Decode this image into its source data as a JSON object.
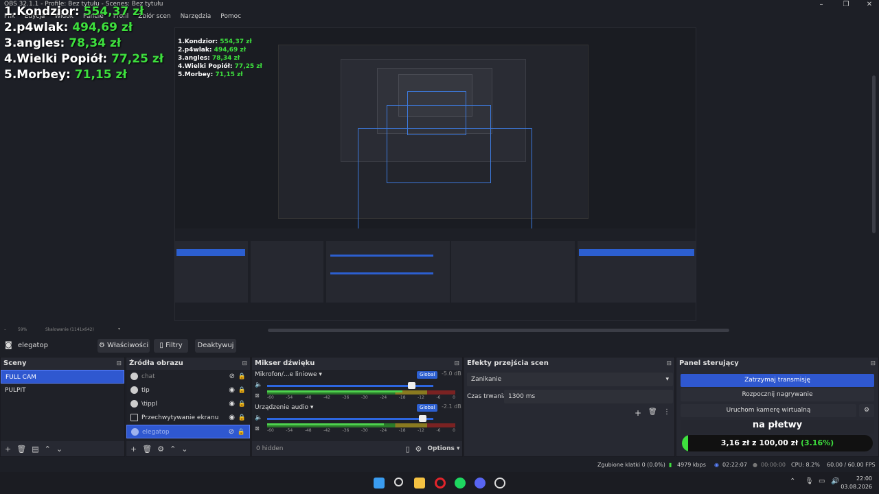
{
  "window": {
    "title": "OBS 32.1.1 - Profile: Bez tytułu - Scenes: Bez tytułu",
    "minimize": "–",
    "maximize": "❐",
    "close": "✕"
  },
  "menu": [
    "Plik",
    "Edycja",
    "Widok",
    "Panele",
    "Profil",
    "Zbiór scen",
    "Narzędzia",
    "Pomoc"
  ],
  "leaderboard": [
    {
      "rank": "1.",
      "name": "Kondzior:",
      "amount": "554,37 zł"
    },
    {
      "rank": "2.",
      "name": "p4wlak:",
      "amount": "494,69 zł"
    },
    {
      "rank": "3.",
      "name": "angles:",
      "amount": "78,34 zł"
    },
    {
      "rank": "4.",
      "name": "Wielki Popiół:",
      "amount": "77,25 zł"
    },
    {
      "rank": "5.",
      "name": "Morbey:",
      "amount": "71,15 zł"
    }
  ],
  "zoom": {
    "percent": "59%",
    "scaling": "Skalowanie (1141x642)"
  },
  "source_toolbar": {
    "source_name": "elegatop",
    "properties": "Właściwości",
    "filters": "Filtry",
    "deactivate": "Deaktywuj"
  },
  "scenes": {
    "title": "Sceny",
    "items": [
      "FULL CAM",
      "PULPIT"
    ]
  },
  "sources": {
    "title": "Źródła obrazu",
    "items": [
      {
        "name": "chat",
        "visible": false
      },
      {
        "name": "tip",
        "visible": true
      },
      {
        "name": "\\tippl",
        "visible": true
      },
      {
        "name": "Przechwytywanie ekranu",
        "visible": true
      },
      {
        "name": "elegatop",
        "visible": false
      }
    ]
  },
  "mixer": {
    "title": "Mikser dźwięku",
    "channels": [
      {
        "name": "Mikrofon/...e liniowe",
        "badge": "Global",
        "db": "-5.0 dB",
        "volume": 0.87,
        "level": 0.72
      },
      {
        "name": "Urządzenie audio",
        "badge": "Global",
        "db": "-2.1 dB",
        "volume": 0.94,
        "level": 0.62
      }
    ],
    "scale": [
      "-60",
      "-54",
      "-48",
      "-42",
      "-36",
      "-30",
      "-24",
      "-18",
      "-12",
      "-6",
      "0"
    ],
    "hidden": "0 hidden",
    "options": "Options"
  },
  "transitions": {
    "title": "Efekty przejścia scen",
    "selected": "Zanikanie",
    "duration_label": "Czas trwania",
    "duration_value": "1300 ms"
  },
  "controls": {
    "title": "Panel sterujący",
    "stop_stream": "Zatrzymaj transmisję",
    "start_record": "Rozpocznij nagrywanie",
    "virtual_cam": "Uruchom kamerę wirtualną",
    "goal_title": "na płetwy",
    "goal_current": "3,16 zł",
    "goal_of": "z",
    "goal_target": "100,00 zł",
    "goal_percent": "(3.16%)",
    "goal_fraction": 0.0316
  },
  "status": {
    "dropped": "Zgubione klatki 0 (0.0%)",
    "bitrate": "4979 kbps",
    "stream_time": "02:22:07",
    "rec_time": "00:00:00",
    "cpu": "CPU: 8.2%",
    "fps": "60.00 / 60.00 FPS"
  },
  "taskbar": {
    "time": "22:00",
    "date": "03.08.2026"
  },
  "colors": {
    "accent": "#2f58d0",
    "green": "#3ee03e",
    "background": "#1d1f26"
  }
}
